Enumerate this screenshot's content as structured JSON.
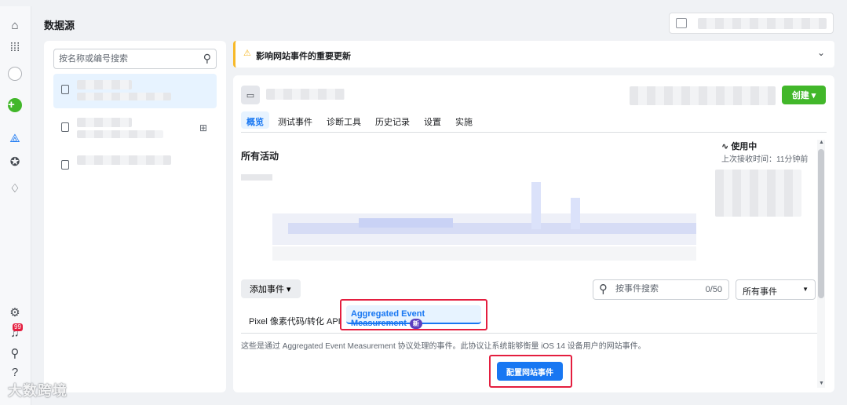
{
  "page": {
    "title": "数据源"
  },
  "rail": {
    "notify_badge": "99"
  },
  "list": {
    "search_placeholder": "按名称或编号搜索"
  },
  "banner": {
    "text": "影响网站事件的重要更新"
  },
  "card": {
    "create_label": "创建",
    "tabs": [
      {
        "label": "概览",
        "active": true
      },
      {
        "label": "测试事件"
      },
      {
        "label": "诊断工具"
      },
      {
        "label": "历史记录"
      },
      {
        "label": "设置"
      },
      {
        "label": "实施"
      }
    ],
    "activity_title": "所有活动",
    "status_label": "使用中",
    "status_sub": "上次接收时间：11分钟前",
    "add_event_label": "添加事件",
    "event_search_placeholder": "按事件搜索",
    "event_count": "0/50",
    "event_filter_label": "所有事件",
    "subtab_pixel": "Pixel 像素代码/转化 API",
    "subtab_aem": "Aggregated Event Measurement",
    "new_badge": "新",
    "description": "这些是通过 Aggregated Event Measurement 协议处理的事件。此协议让系统能够衡量 iOS 14 设备用户的网站事件。",
    "configure_label": "配置网站事件"
  },
  "watermark": "大数跨境",
  "colors": {
    "primary": "#1877f2",
    "green": "#42b72a",
    "highlight": "#e41e3f",
    "warn": "#f7b928"
  }
}
